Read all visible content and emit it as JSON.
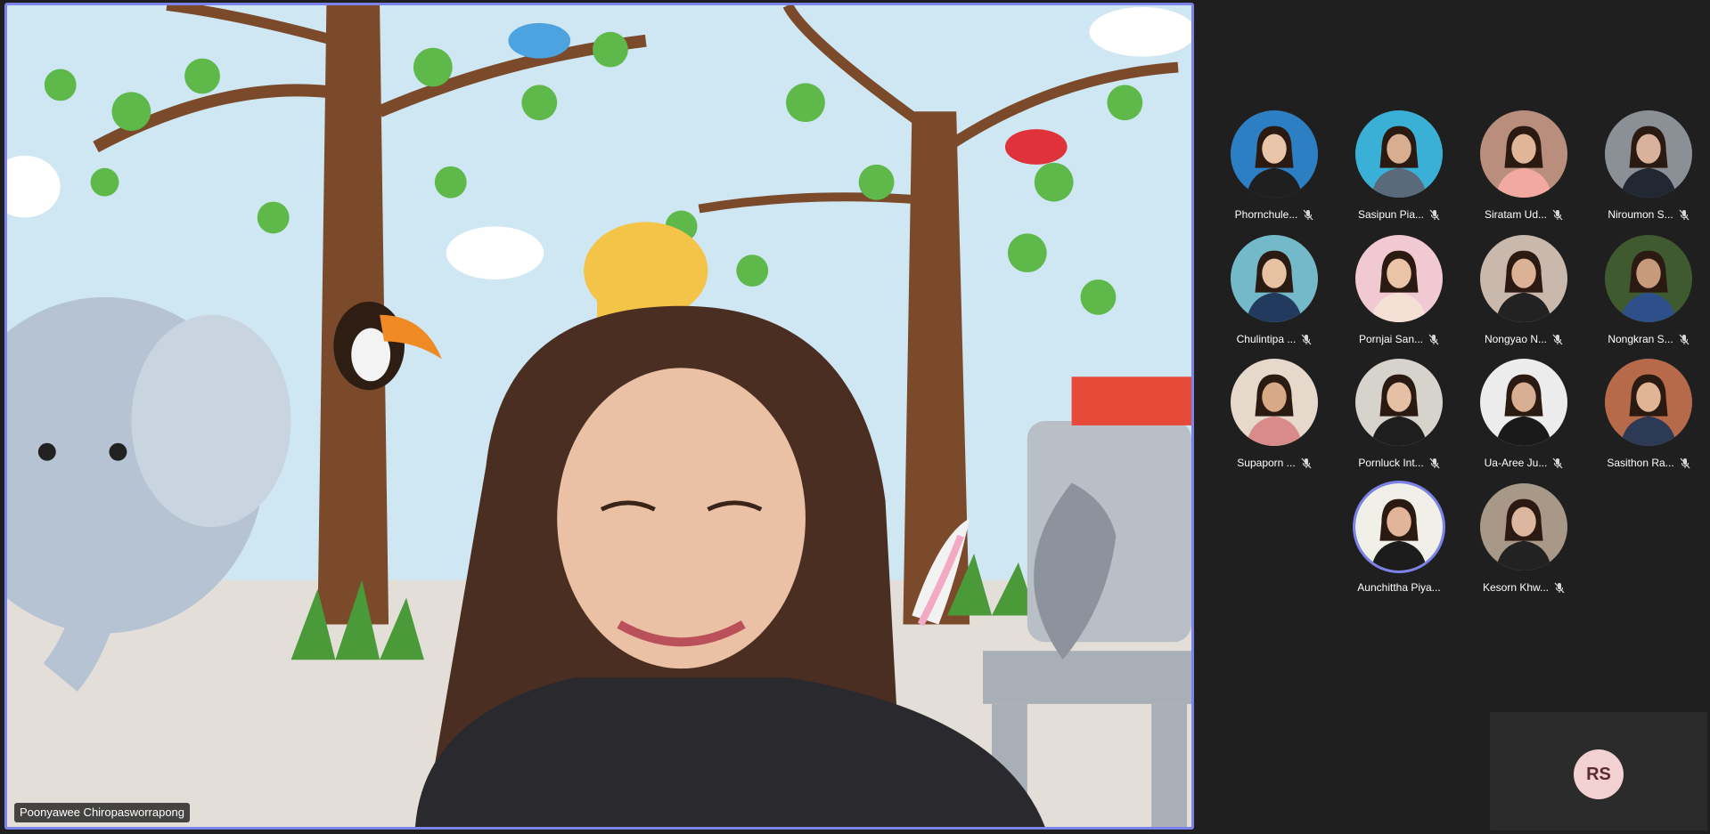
{
  "stage": {
    "speaker_name": "Poonyawee Chiropasworrapong",
    "border_color": "#7b83eb"
  },
  "participants": [
    {
      "name": "Phornchule...",
      "muted": true,
      "bg": "#2d7fc4",
      "shirt": "#1f1f1f",
      "skin": "#e8c4a8"
    },
    {
      "name": "Sasipun Pia...",
      "muted": true,
      "bg": "#3bb0d6",
      "shirt": "#5a6a7a",
      "skin": "#d9ad8f"
    },
    {
      "name": "Siratam Ud...",
      "muted": true,
      "bg": "#b98e7c",
      "shirt": "#f2a9a0",
      "skin": "#e0b598"
    },
    {
      "name": "Niroumon S...",
      "muted": true,
      "bg": "#8b8f96",
      "shirt": "#222831",
      "skin": "#d8b29a"
    },
    {
      "name": "Chulintipa ...",
      "muted": true,
      "bg": "#74b9c9",
      "shirt": "#223a5e",
      "skin": "#e6c1a2"
    },
    {
      "name": "Pornjai San...",
      "muted": true,
      "bg": "#f1c9d2",
      "shirt": "#f4e0d5",
      "skin": "#ebc4a7"
    },
    {
      "name": "Nongyao N...",
      "muted": true,
      "bg": "#c9b9ad",
      "shirt": "#222222",
      "skin": "#dcb296"
    },
    {
      "name": "Nongkran S...",
      "muted": true,
      "bg": "#3f5a2f",
      "shirt": "#2f4f8a",
      "skin": "#c89a7c"
    },
    {
      "name": "Supaporn ...",
      "muted": true,
      "bg": "#e7d8cc",
      "shirt": "#d98a8a",
      "skin": "#d7a987"
    },
    {
      "name": "Pornluck Int...",
      "muted": true,
      "bg": "#d6d2cc",
      "shirt": "#1e1e1e",
      "skin": "#e5c0a4"
    },
    {
      "name": "Ua-Aree Ju...",
      "muted": true,
      "bg": "#ececec",
      "shirt": "#1a1a1a",
      "skin": "#d8ae92"
    },
    {
      "name": "Sasithon Ra...",
      "muted": true,
      "bg": "#b76a4a",
      "shirt": "#2d3a55",
      "skin": "#dfb596"
    },
    {
      "name": "Aunchittha Piya...",
      "muted": false,
      "bg": "#f0efe8",
      "shirt": "#1c1c1c",
      "skin": "#e2b59a"
    },
    {
      "name": "Kesorn Khw...",
      "muted": true,
      "bg": "#a89888",
      "shirt": "#222222",
      "skin": "#dcb69e"
    }
  ],
  "self_view": {
    "initials": "RS",
    "avatar_bg": "#f3d1d3"
  }
}
